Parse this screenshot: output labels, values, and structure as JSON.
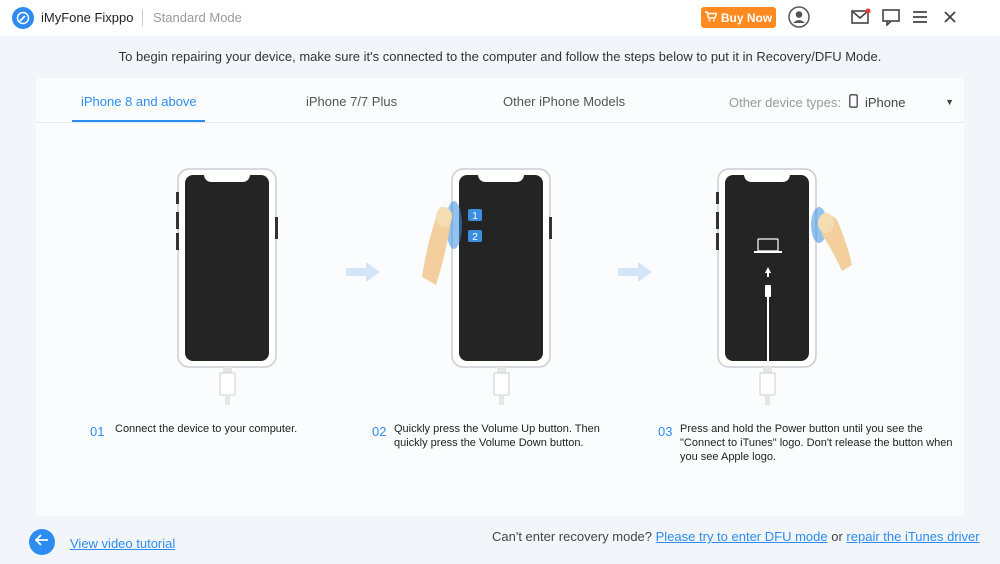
{
  "titlebar": {
    "app_name": "iMyFone Fixppo",
    "mode": "Standard Mode",
    "buy_label": "Buy Now"
  },
  "instruction": "To begin repairing your device, make sure it's connected to the computer and follow the steps below to put it in Recovery/DFU Mode.",
  "tabs": [
    {
      "label": "iPhone 8 and above",
      "active": true
    },
    {
      "label": "iPhone 7/7 Plus",
      "active": false
    },
    {
      "label": "Other iPhone Models",
      "active": false
    }
  ],
  "device_types": {
    "label": "Other device types:",
    "selected": "iPhone"
  },
  "steps": [
    {
      "num": "01",
      "text": "Connect the device to your computer."
    },
    {
      "num": "02",
      "text": "Quickly press the Volume Up button. Then quickly press the Volume Down button."
    },
    {
      "num": "03",
      "text": "Press and hold the Power button until you see the \"Connect to iTunes\" logo. Don't release the button when you see Apple logo."
    }
  ],
  "volume_badges": [
    "1",
    "2"
  ],
  "footer": {
    "video_link": "View video tutorial",
    "prompt": "Can't enter recovery mode?",
    "dfu_link": "Please try to enter DFU mode",
    "or": "or",
    "itunes_link": "repair the iTunes driver"
  },
  "colors": {
    "accent": "#2d8cf0",
    "buy": "#ff8a1f"
  },
  "icons": [
    "app-logo-icon",
    "cart-icon",
    "user-icon",
    "mail-icon",
    "chat-icon",
    "menu-icon",
    "close-icon",
    "phone-small-icon",
    "caret-down-icon",
    "arrow-left-icon"
  ]
}
